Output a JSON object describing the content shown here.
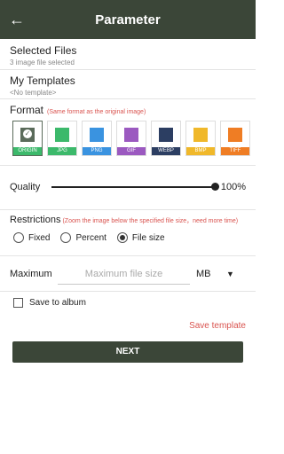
{
  "appbar": {
    "title": "Parameter",
    "back_icon": "arrow-left-icon"
  },
  "selected_files": {
    "title": "Selected Files",
    "subtitle": "3 image file selected"
  },
  "templates": {
    "title": "My Templates",
    "subtitle": "<No template>"
  },
  "format": {
    "title": "Format",
    "note": "(Same format as the original image)",
    "items": [
      {
        "label": "ORIGIN",
        "color": "#5a6b5a",
        "selected": true
      },
      {
        "label": "JPG",
        "color": "#3cb96b"
      },
      {
        "label": "PNG",
        "color": "#3a93e0"
      },
      {
        "label": "GIF",
        "color": "#9b59c0"
      },
      {
        "label": "WEBP",
        "color": "#2c3e62"
      },
      {
        "label": "BMP",
        "color": "#f0b82a"
      },
      {
        "label": "TIFF",
        "color": "#ef7d24"
      }
    ]
  },
  "quality": {
    "label": "Quality",
    "value": "100%",
    "level": 1.0
  },
  "restrictions": {
    "title": "Restrictions",
    "note": "(Zoom the image below the specified file size，need more time)",
    "options": [
      "Fixed",
      "Percent",
      "File size"
    ],
    "selected": "File size"
  },
  "maximum": {
    "label": "Maximum",
    "placeholder": "Maximum file size",
    "unit": "MB"
  },
  "album": {
    "label": "Save to album",
    "checked": false
  },
  "save_template": "Save template",
  "next": "NEXT"
}
